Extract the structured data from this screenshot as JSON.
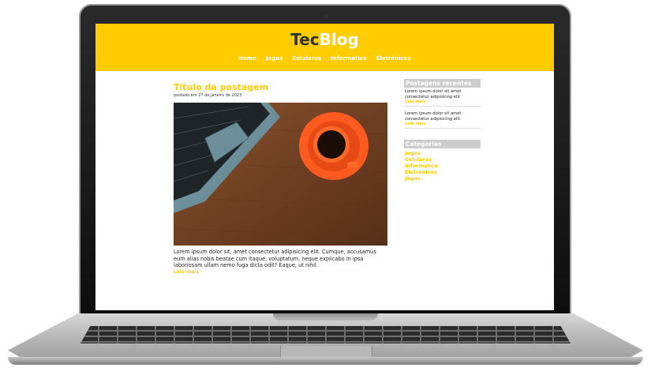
{
  "site": {
    "logo": {
      "part1": "Tec",
      "part2": "Blog"
    },
    "nav": [
      "Home",
      "Jogos",
      "Celulares",
      "Informatica",
      "Eletrônicos"
    ]
  },
  "post": {
    "title": "Titulo da postagem",
    "meta": "postado em 27 de janeiro de 2023",
    "excerpt": "Lorem ipsum dolor sit, amet consectetur adipisicing elit. Cumque, accusamus eum alias nobis beatae cum itaque, voluptatum, neque explicabo in ipsa laboriosam ullam nemo fuga dicta odit? Eaque, ut nihil.",
    "read_more": "Leia mais"
  },
  "sidebar": {
    "recent_title": "Postagens recentes",
    "recent_posts": [
      {
        "text": "Lorem ipsum dolor sit amet consectetur adipisicing elit.",
        "more": "Leia mais"
      },
      {
        "text": "Lorem ipsum dolor sit amet consectetur adipisicing elit.",
        "more": "Leia mais"
      }
    ],
    "categories_title": "Categorias",
    "categories": [
      "Jogos",
      "Celulares",
      "Informatica",
      "Eletrônicos",
      "Jogos"
    ]
  },
  "colors": {
    "accent": "#ffcc00",
    "sidebar_header": "#cccccc"
  },
  "icons": {
    "camera": "camera-icon"
  }
}
